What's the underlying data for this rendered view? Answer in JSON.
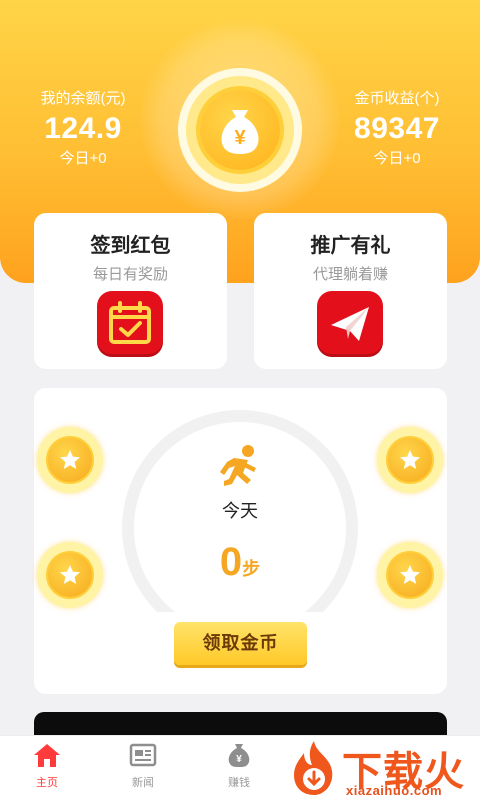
{
  "header": {
    "balance": {
      "label": "我的余额(元)",
      "value": "124.9",
      "today": "今日+0"
    },
    "coins": {
      "label": "金币收益(个)",
      "value": "89347",
      "today": "今日+0"
    },
    "center_icon": "money-bag-icon",
    "center_symbol": "¥"
  },
  "cards": [
    {
      "title": "签到红包",
      "subtitle": "每日有奖励",
      "icon": "calendar-check-icon"
    },
    {
      "title": "推广有礼",
      "subtitle": "代理躺着赚",
      "icon": "paper-plane-icon"
    }
  ],
  "steps_panel": {
    "icon": "running-man-icon",
    "today_label": "今天",
    "steps_value": "0",
    "steps_unit": "步",
    "button_label": "领取金币",
    "coin_icon": "star-coin-icon"
  },
  "tabbar": [
    {
      "label": "主页",
      "icon": "home-icon",
      "active": true
    },
    {
      "label": "新闻",
      "icon": "news-icon",
      "active": false
    },
    {
      "label": "赚钱",
      "icon": "money-bag-icon",
      "active": false
    }
  ],
  "watermark": {
    "text": "下载火",
    "url": "xiazaihuo.com"
  },
  "colors": {
    "accent": "#ffbe33",
    "red": "#e3101b",
    "steps": "#f5a623",
    "tab_active": "#ff3b3b"
  }
}
